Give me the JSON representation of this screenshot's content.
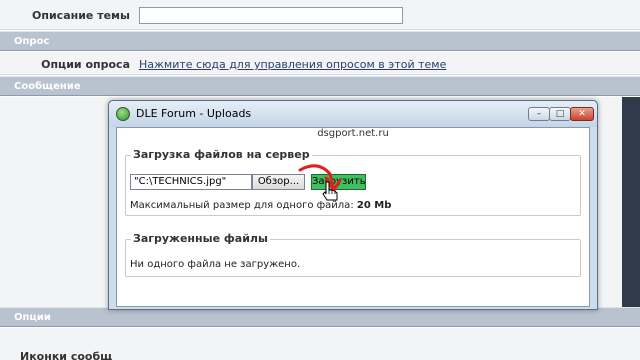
{
  "background": {
    "title_label": "Описание темы",
    "poll_section": "Опрос",
    "poll_label": "Опции опроса",
    "poll_link": "Нажмите сюда для управления опросом в этой теме",
    "message_section": "Сообщение",
    "options_section": "Опции",
    "bottom_label": "Иконки сообщ"
  },
  "window": {
    "title": "DLE Forum - Uploads",
    "site": "dsgport.net.ru",
    "upload_legend": "Загрузка файлов на сервер",
    "file_value": "\"C:\\TECHNICS.jpg\"",
    "browse_label": "Обзор...",
    "upload_label": "Загрузить",
    "max_size_text": "Максимальный размер для одного файла:",
    "max_size_value": "20 Mb",
    "uploaded_legend": "Загруженные файлы",
    "no_files_text": "Ни одного файла не загружено."
  },
  "colors": {
    "section_header": "#b9c3cf",
    "upload_button": "#3fbf5f",
    "annotation_red": "#e0201a"
  },
  "icons": {
    "window_icon": "globe-icon",
    "minimize": "minimize-icon",
    "maximize": "maximize-icon",
    "close": "close-icon",
    "cursor": "hand-cursor-icon"
  }
}
